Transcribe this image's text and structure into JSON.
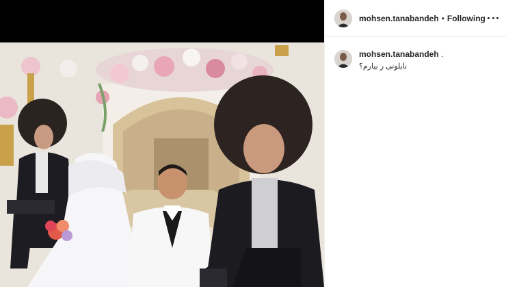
{
  "post": {
    "image_alt": "Wedding photo",
    "header": {
      "username": "mohsen.tanabandeh",
      "separator": "•",
      "follow_state": "Following",
      "more_icon": "more-options-icon"
    },
    "caption": {
      "username": "mohsen.tanabandeh",
      "trailing": ".",
      "text": "نایلونی ر بیارم؟"
    }
  },
  "colors": {
    "text": "#262626",
    "divider": "#efefef",
    "media_bg": "#000000"
  }
}
